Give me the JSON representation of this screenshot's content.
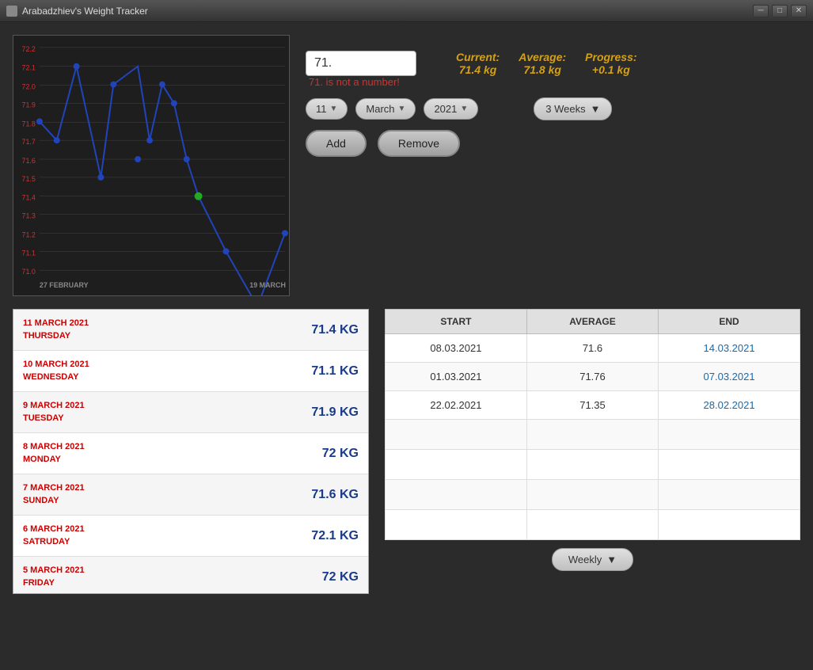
{
  "window": {
    "title": "Arabadzhiev's Weight Tracker"
  },
  "stats": {
    "current_label": "Current:",
    "current_value": "71.4 kg",
    "average_label": "Average:",
    "average_value": "71.8 kg",
    "progress_label": "Progress:",
    "progress_value": "+0.1 kg"
  },
  "input": {
    "value": "71.",
    "error": "71. is not a number!"
  },
  "selectors": {
    "day": "11",
    "month": "March",
    "year": "2021",
    "period": "3 Weeks"
  },
  "buttons": {
    "add": "Add",
    "remove": "Remove",
    "weekly": "Weekly"
  },
  "chart": {
    "y_labels": [
      "72.2",
      "72.1",
      "72.0",
      "71.9",
      "71.8",
      "71.7",
      "71.6",
      "71.5",
      "71.4",
      "71.3",
      "71.2",
      "71.1",
      "71.0"
    ],
    "x_start": "27 FEBRUARY",
    "x_end": "19 MARCH"
  },
  "log": [
    {
      "date": "11 MARCH 2021",
      "day": "THURSDAY",
      "weight": "71.4 KG"
    },
    {
      "date": "10 MARCH 2021",
      "day": "WEDNESDAY",
      "weight": "71.1 KG"
    },
    {
      "date": "9 MARCH 2021",
      "day": "TUESDAY",
      "weight": "71.9 KG"
    },
    {
      "date": "8 MARCH 2021",
      "day": "MONDAY",
      "weight": "72 KG"
    },
    {
      "date": "7 MARCH 2021",
      "day": "SUNDAY",
      "weight": "71.6 KG"
    },
    {
      "date": "6 MARCH 2021",
      "day": "SATRUDAY",
      "weight": "72.1 KG"
    },
    {
      "date": "5 MARCH 2021",
      "day": "FRIDAY",
      "weight": "72 KG"
    }
  ],
  "weekly_table": {
    "headers": [
      "START",
      "AVERAGE",
      "END"
    ],
    "rows": [
      {
        "start": "08.03.2021",
        "average": "71.6",
        "end": "14.03.2021"
      },
      {
        "start": "01.03.2021",
        "average": "71.76",
        "end": "07.03.2021"
      },
      {
        "start": "22.02.2021",
        "average": "71.35",
        "end": "28.02.2021"
      }
    ]
  }
}
